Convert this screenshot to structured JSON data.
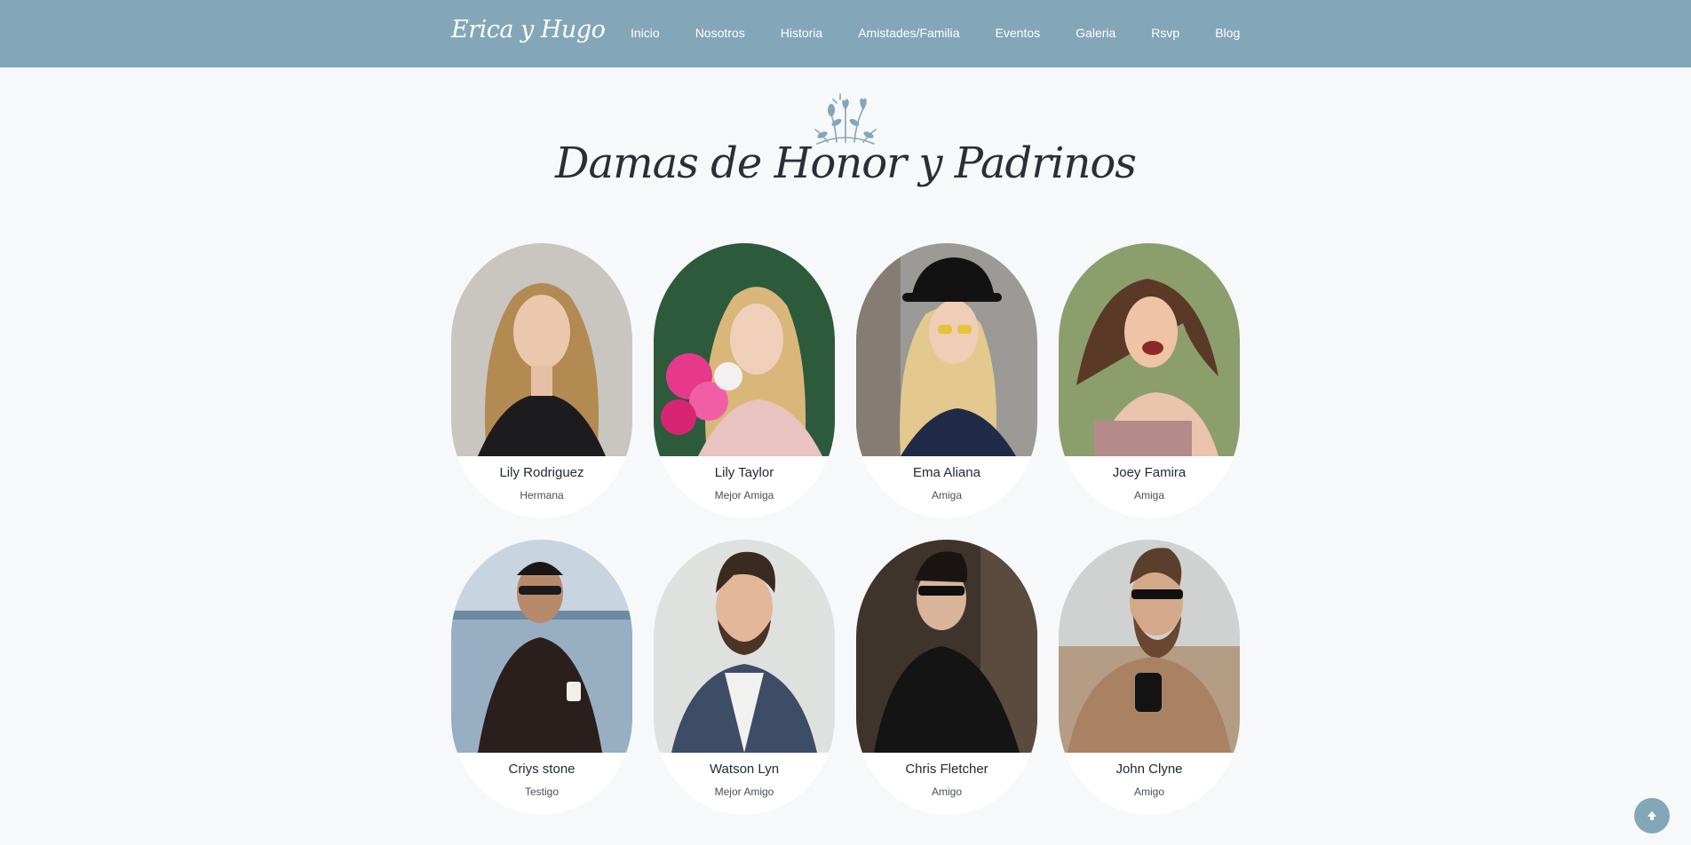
{
  "brand": "Erica y Hugo",
  "nav": [
    "Inicio",
    "Nosotros",
    "Historia",
    "Amistades/Familia",
    "Eventos",
    "Galeria",
    "Rsvp",
    "Blog"
  ],
  "section": {
    "title": "Damas de Honor y Padrinos",
    "icon": "flower-bouquet-icon"
  },
  "people": [
    {
      "name": "Lily Rodriguez",
      "role": "Hermana"
    },
    {
      "name": "Lily Taylor",
      "role": "Mejor Amiga"
    },
    {
      "name": "Ema Aliana",
      "role": "Amiga"
    },
    {
      "name": "Joey Famira",
      "role": "Amiga"
    },
    {
      "name": "Criys stone",
      "role": "Testigo"
    },
    {
      "name": "Watson Lyn",
      "role": "Mejor Amigo"
    },
    {
      "name": "Chris Fletcher",
      "role": "Amigo"
    },
    {
      "name": "John Clyne",
      "role": "Amigo"
    }
  ],
  "colors": {
    "accent": "#83a7b8",
    "background": "#f6f8fa",
    "text_dark": "#222a35"
  },
  "scroll_top_icon": "arrow-up-icon"
}
